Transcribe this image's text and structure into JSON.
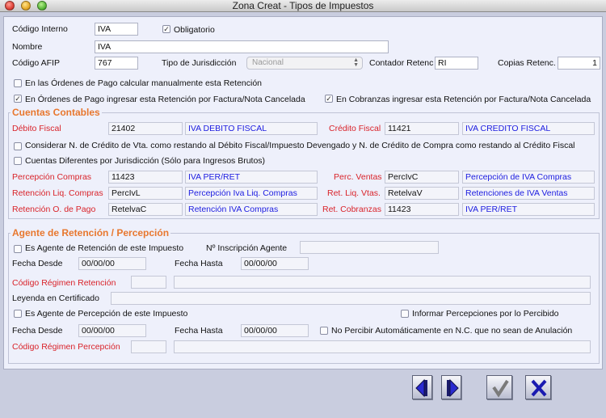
{
  "window": {
    "title": "Zona Creat - Tipos de Impuestos"
  },
  "general": {
    "codigo_interno_label": "Código Interno",
    "codigo_interno_value": "IVA",
    "obligatorio_label": "Obligatorio",
    "obligatorio_checked": true,
    "nombre_label": "Nombre",
    "nombre_value": "IVA",
    "codigo_afip_label": "Código AFIP",
    "codigo_afip_value": "767",
    "tipo_jurisdiccion_label": "Tipo de Jurisdicción",
    "tipo_jurisdiccion_value": "Nacional",
    "contador_retenc_label": "Contador Retenc",
    "contador_retenc_value": "RI",
    "copias_retenc_label": "Copias Retenc.",
    "copias_retenc_value": "1"
  },
  "options": {
    "ordenes_manual_label": "En las Órdenes de Pago calcular manualmente esta Retención",
    "ordenes_manual_checked": false,
    "ordenes_factura_label": "En Órdenes de Pago ingresar esta Retención por Factura/Nota Cancelada",
    "ordenes_factura_checked": true,
    "cobranzas_factura_label": "En Cobranzas ingresar esta Retención por Factura/Nota Cancelada",
    "cobranzas_factura_checked": true
  },
  "cuentas": {
    "title": "Cuentas Contables",
    "debito_fiscal_label": "Débito Fiscal",
    "debito_fiscal_code": "21402",
    "debito_fiscal_name": "IVA DEBITO FISCAL",
    "credito_fiscal_label": "Crédito Fiscal",
    "credito_fiscal_code": "11421",
    "credito_fiscal_name": "IVA CREDITO FISCAL",
    "considerar_label": "Considerar N. de Crédito de Vta. como restando al Débito Fiscal/Impuesto Devengado y N. de Crédito de Compra como restando al Crédito Fiscal",
    "considerar_checked": false,
    "diferentes_label": "Cuentas Diferentes por Jurisdicción (Sólo para Ingresos Brutos)",
    "diferentes_checked": false,
    "percepcion_compras_label": "Percepción Compras",
    "percepcion_compras_code": "11423",
    "percepcion_compras_name": "IVA PER/RET",
    "perc_ventas_label": "Perc. Ventas",
    "perc_ventas_code": "PercIvC",
    "perc_ventas_name": "Percepción de IVA Compras",
    "retencion_liq_compras_label": "Retención Liq. Compras",
    "retencion_liq_compras_code": "PercIvL",
    "retencion_liq_compras_name": "Percepción Iva Liq. Compras",
    "ret_liq_vtas_label": "Ret. Liq. Vtas.",
    "ret_liq_vtas_code": "RetelvaV",
    "ret_liq_vtas_name": "Retenciones de IVA Ventas",
    "retencion_op_label": "Retención O. de Pago",
    "retencion_op_code": "RetelvaC",
    "retencion_op_name": "Retención IVA Compras",
    "ret_cobranzas_label": "Ret. Cobranzas",
    "ret_cobranzas_code": "11423",
    "ret_cobranzas_name": "IVA PER/RET"
  },
  "agente": {
    "title": "Agente de Retención / Percepción",
    "es_agente_ret_label": "Es Agente de Retención de este Impuesto",
    "es_agente_ret_checked": false,
    "inscripcion_label": "Nº Inscripción Agente",
    "inscripcion_value": "",
    "fecha_desde_label": "Fecha Desde",
    "fecha_desde_value": "00/00/00",
    "fecha_hasta_label": "Fecha Hasta",
    "fecha_hasta_value": "00/00/00",
    "regimen_ret_label": "Código Régimen Retención",
    "leyenda_label": "Leyenda en Certificado",
    "es_agente_perc_label": "Es Agente de Percepción de este Impuesto",
    "es_agente_perc_checked": false,
    "informar_label": "Informar Percepciones por lo Percibido",
    "informar_checked": false,
    "fecha_desde2_label": "Fecha Desde",
    "fecha_desde2_value": "00/00/00",
    "fecha_hasta2_label": "Fecha Hasta",
    "fecha_hasta2_value": "00/00/00",
    "no_percibir_label": "No Percibir Automáticamente en N.C. que no sean de Anulación",
    "no_percibir_checked": false,
    "regimen_perc_label": "Código Régimen Percepción"
  },
  "colors": {
    "accent_red": "#d9232a",
    "group_title": "#e8772e",
    "account_blue": "#1c1ce0"
  },
  "icons": [
    "previous-icon",
    "next-icon",
    "check-icon",
    "cancel-icon"
  ]
}
